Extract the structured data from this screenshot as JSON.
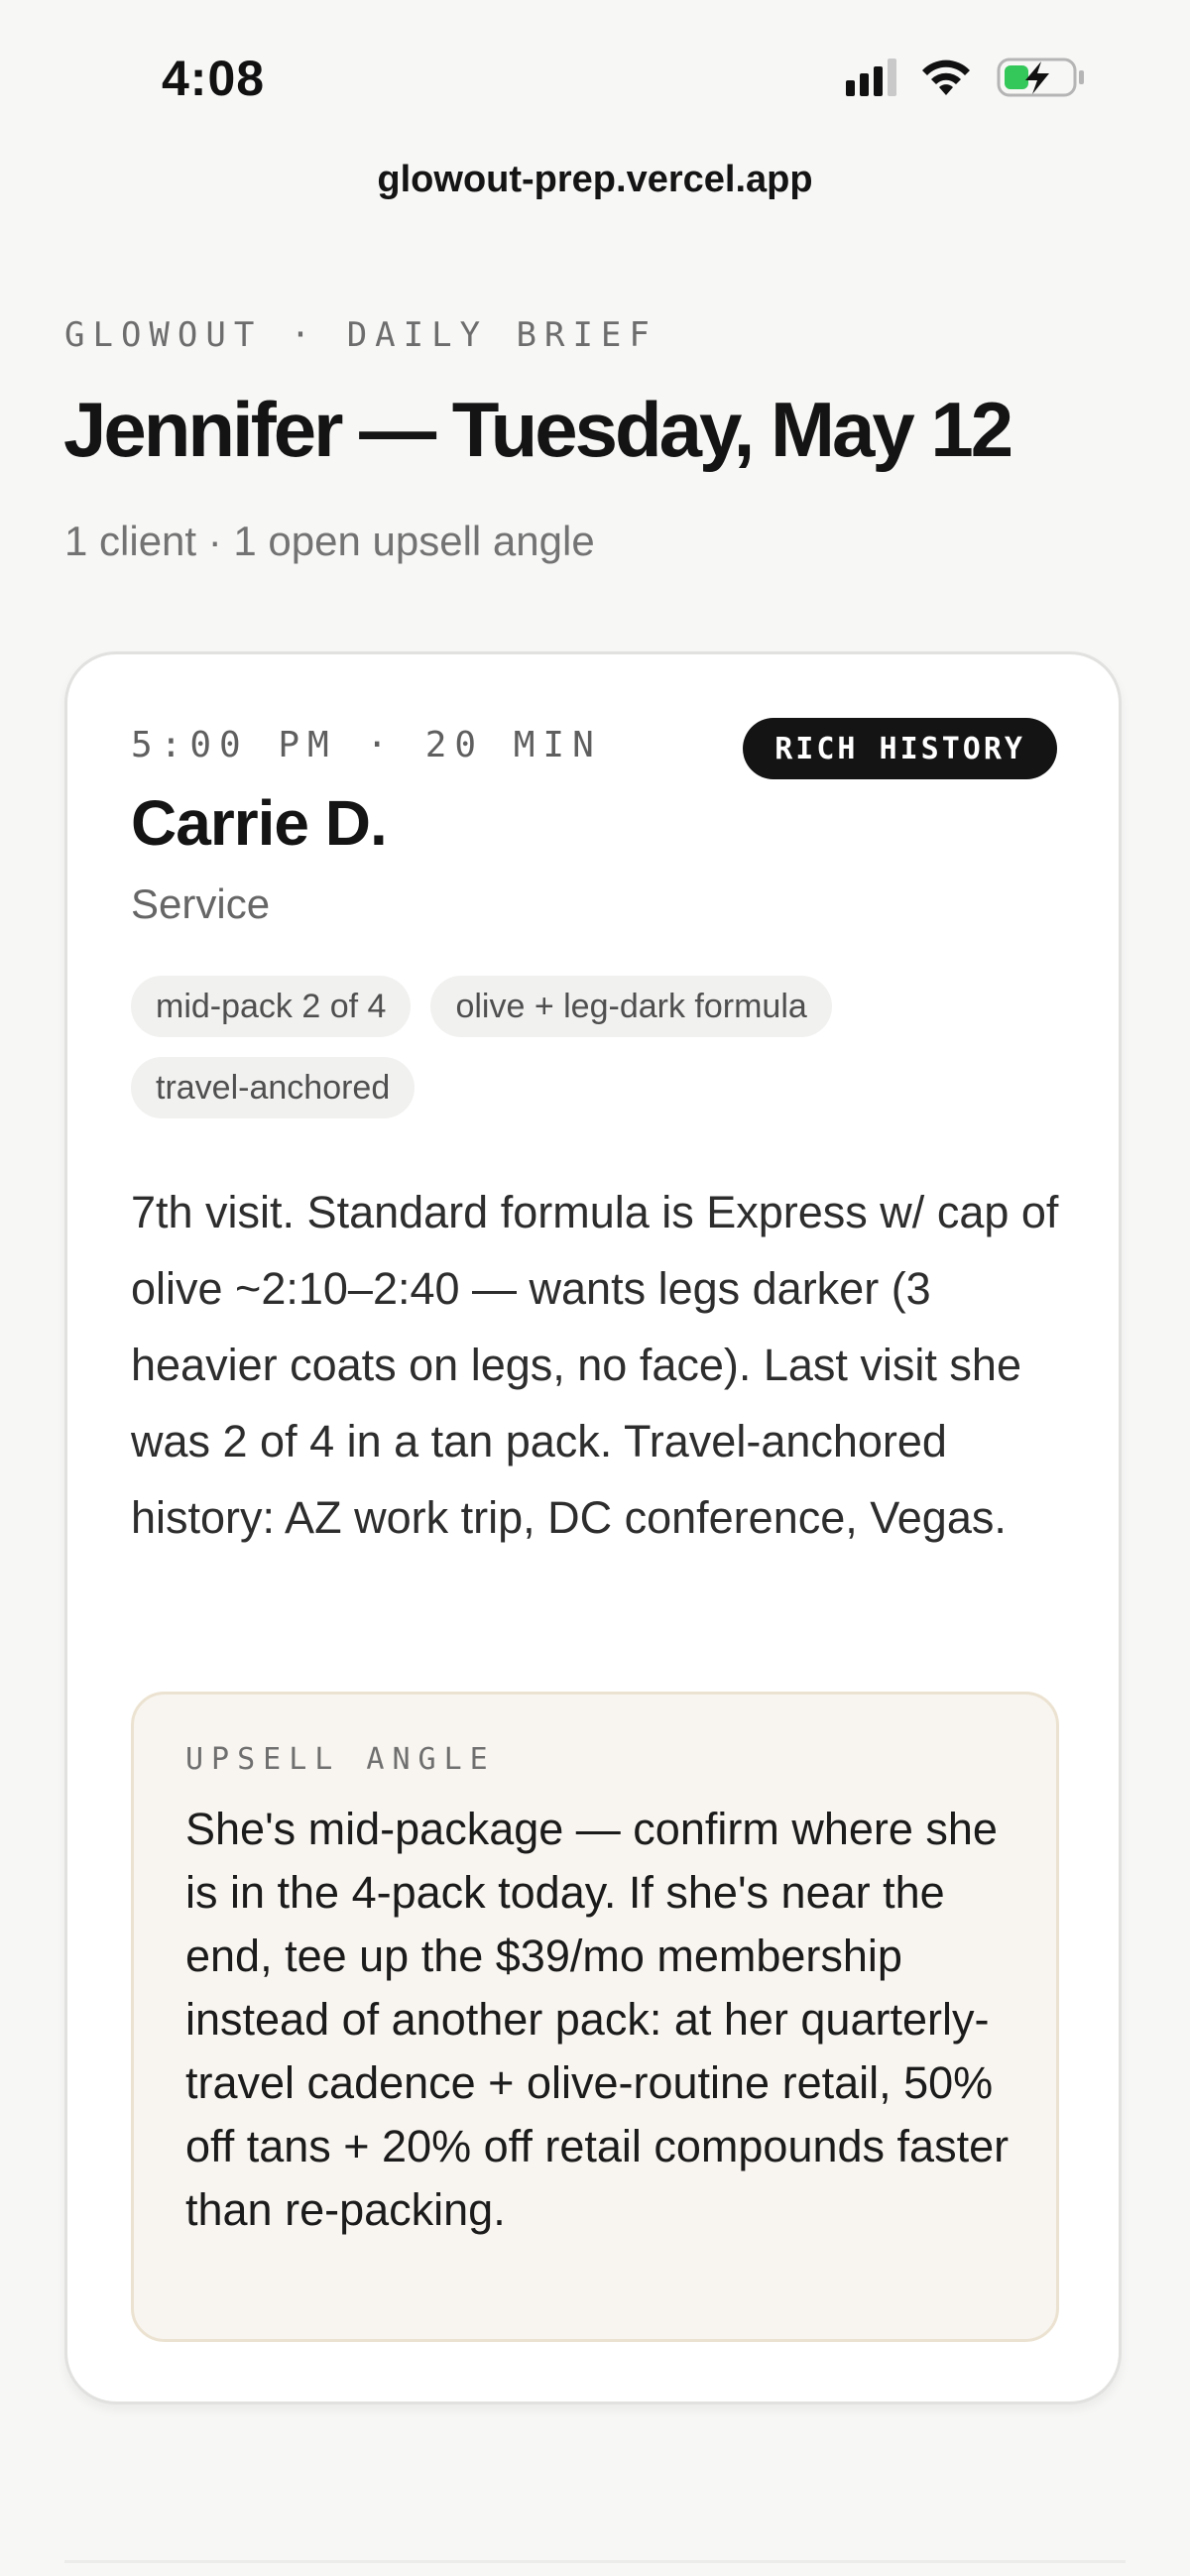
{
  "status_bar": {
    "time": "4:08",
    "icons": [
      "cellular-signal-icon",
      "wifi-icon",
      "battery-charging-icon"
    ],
    "battery_color": "#34c759"
  },
  "browser": {
    "url": "glowout-prep.vercel.app"
  },
  "header": {
    "eyebrow": "GLOWOUT · DAILY BRIEF",
    "title": "Jennifer — Tuesday, May 12",
    "subtitle": "1 client · 1 open upsell angle"
  },
  "appointment": {
    "time": "5:00 PM · 20 MIN",
    "badge": "RICH HISTORY",
    "client_name": "Carrie D.",
    "service": "Service",
    "tags": [
      "mid-pack 2 of 4",
      "olive + leg-dark formula",
      "travel-anchored"
    ],
    "summary": "7th visit. Standard formula is Express w/ cap of olive ~2:10–2:40 — wants legs darker (3 heavier coats on legs, no face). Last visit she was 2 of 4 in a tan pack. Travel-anchored history: AZ work trip, DC conference, Vegas.",
    "upsell": {
      "label": "UPSELL ANGLE",
      "text": "She's mid-package — confirm where she is in the 4-pack today. If she's near the end, tee up the $39/mo membership instead of another pack: at her quarterly-travel cadence + olive-routine retail, 50% off tans + 20% off retail compounds faster than re-packing."
    }
  }
}
